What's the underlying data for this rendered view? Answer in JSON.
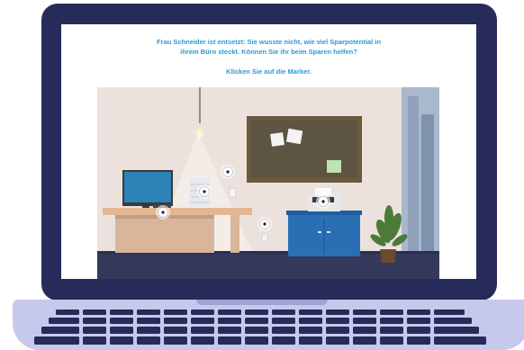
{
  "instructions": {
    "line1": "Frau Schneider ist entsetzt: Sie wusste nicht, wie viel Sparpotential in",
    "line2": "ihrem Büro steckt. Können Sie ihr beim Sparen helfen?",
    "line3": "Klicken Sie auf die Marker."
  },
  "colors": {
    "accent": "#2b9ad6",
    "laptop_frame": "#262b5a",
    "keyboard_base": "#c7c9ec",
    "keys": "#262b5a"
  },
  "markers": [
    {
      "name": "marker-lamp"
    },
    {
      "name": "marker-paper-stack"
    },
    {
      "name": "marker-monitor"
    },
    {
      "name": "marker-printer"
    },
    {
      "name": "marker-socket"
    }
  ]
}
